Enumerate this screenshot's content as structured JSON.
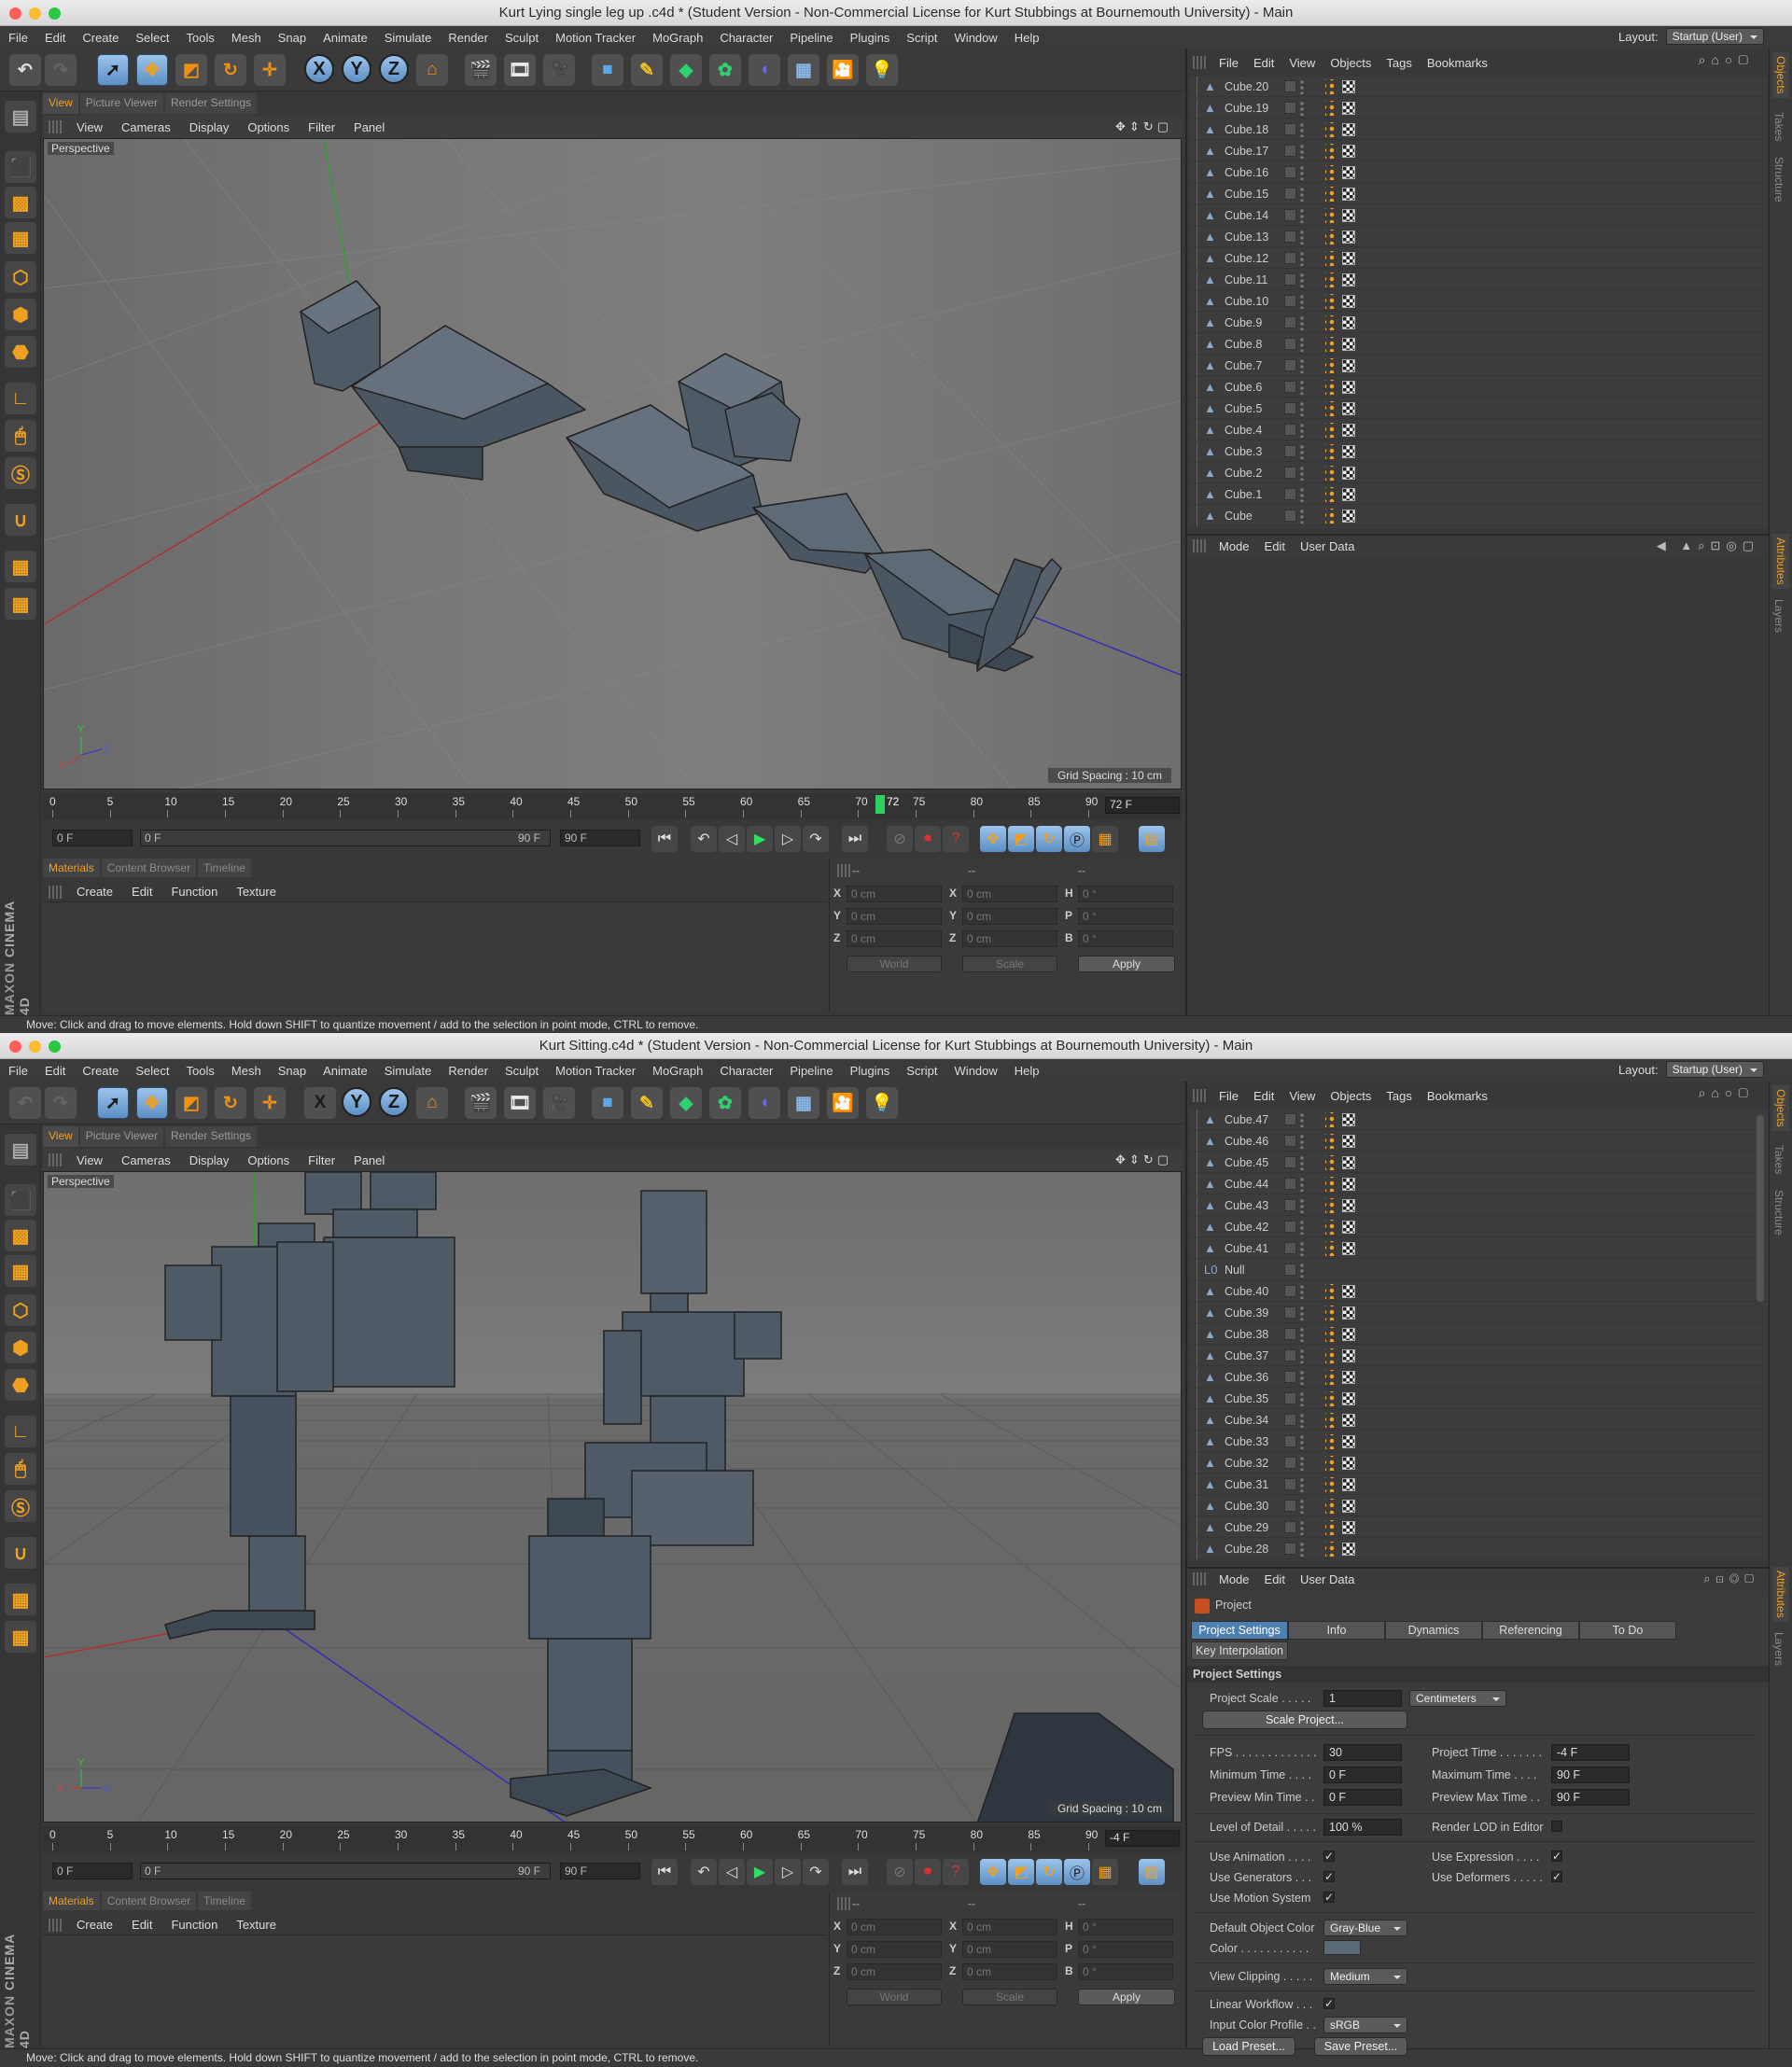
{
  "menus": [
    "File",
    "Edit",
    "Create",
    "Select",
    "Tools",
    "Mesh",
    "Snap",
    "Animate",
    "Simulate",
    "Render",
    "Sculpt",
    "Motion Tracker",
    "MoGraph",
    "Character",
    "Pipeline",
    "Plugins",
    "Script",
    "Window",
    "Help"
  ],
  "layout_label": "Layout:",
  "layout_value": "Startup (User)",
  "viewport_tabs": [
    "View",
    "Picture Viewer",
    "Render Settings"
  ],
  "viewport_menu": [
    "View",
    "Cameras",
    "Display",
    "Options",
    "Filter",
    "Panel"
  ],
  "perspective_label": "Perspective",
  "grid_spacing": "Grid Spacing : 10 cm",
  "timeline_ticks": [
    "0",
    "5",
    "10",
    "15",
    "20",
    "25",
    "30",
    "35",
    "40",
    "45",
    "50",
    "55",
    "60",
    "65",
    "70",
    "75",
    "80",
    "85",
    "90"
  ],
  "frame_start_field": "0 F",
  "range_left": "0 F",
  "range_right": "90 F",
  "frame_end_field": "90 F",
  "lower_tabs": [
    "Materials",
    "Content Browser",
    "Timeline"
  ],
  "material_menu": [
    "Create",
    "Edit",
    "Function",
    "Texture"
  ],
  "coords": {
    "dashes": [
      "--",
      "--",
      "--"
    ],
    "rows": [
      {
        "a": "X",
        "v1": "0 cm",
        "b": "X",
        "v2": "0 cm",
        "c": "H",
        "v3": "0 °"
      },
      {
        "a": "Y",
        "v1": "0 cm",
        "b": "Y",
        "v2": "0 cm",
        "c": "P",
        "v3": "0 °"
      },
      {
        "a": "Z",
        "v1": "0 cm",
        "b": "Z",
        "v2": "0 cm",
        "c": "B",
        "v3": "0 °"
      }
    ],
    "world": "World",
    "scale": "Scale",
    "apply": "Apply"
  },
  "status_text": "Move: Click and drag to move elements. Hold down SHIFT to quantize movement / add to the selection in point mode, CTRL to remove.",
  "object_menu": [
    "File",
    "Edit",
    "View",
    "Objects",
    "Tags",
    "Bookmarks"
  ],
  "attr_menu": [
    "Mode",
    "Edit",
    "User Data"
  ],
  "side_tabs_top": [
    "Objects",
    "Takes",
    "Structure"
  ],
  "side_tabs_bottom": [
    "Attributes",
    "Layers"
  ],
  "brand": {
    "maxon": "MAXON",
    "c4d": "CINEMA 4D"
  },
  "window1": {
    "title": "Kurt Lying single leg up .c4d * (Student Version - Non-Commercial License for Kurt Stubbings at Bournemouth University) - Main",
    "current_frame_marker": "72",
    "frame_field": "72 F",
    "current_frame": 72,
    "objects": [
      "Cube.20",
      "Cube.19",
      "Cube.18",
      "Cube.17",
      "Cube.16",
      "Cube.15",
      "Cube.14",
      "Cube.13",
      "Cube.12",
      "Cube.11",
      "Cube.10",
      "Cube.9",
      "Cube.8",
      "Cube.7",
      "Cube.6",
      "Cube.5",
      "Cube.4",
      "Cube.3",
      "Cube.2",
      "Cube.1",
      "Cube"
    ]
  },
  "window2": {
    "title": "Kurt Sitting.c4d * (Student Version - Non-Commercial License for Kurt Stubbings at Bournemouth University) - Main",
    "frame_field": "-4 F",
    "objects": [
      "Cube.47",
      "Cube.46",
      "Cube.45",
      "Cube.44",
      "Cube.43",
      "Cube.42",
      "Cube.41",
      "Null",
      "Cube.40",
      "Cube.39",
      "Cube.38",
      "Cube.37",
      "Cube.36",
      "Cube.35",
      "Cube.34",
      "Cube.33",
      "Cube.32",
      "Cube.31",
      "Cube.30",
      "Cube.29",
      "Cube.28"
    ],
    "project": {
      "header": "Project",
      "tabs": [
        "Project Settings",
        "Info",
        "Dynamics",
        "Referencing",
        "To Do"
      ],
      "tab2": "Key Interpolation",
      "section": "Project Settings",
      "project_scale_label": "Project Scale . . . . .",
      "project_scale_value": "1",
      "project_scale_unit": "Centimeters",
      "scale_project_button": "Scale Project...",
      "fps_label": "FPS . . . . . . . . . . . . .",
      "fps_value": "30",
      "project_time_label": "Project Time . . . . . . .",
      "project_time_value": "-4 F",
      "min_time_label": "Minimum Time . . . .",
      "min_time_value": "0 F",
      "max_time_label": "Maximum Time . . . .",
      "max_time_value": "90 F",
      "prev_min_label": "Preview Min Time . .",
      "prev_min_value": "0 F",
      "prev_max_label": "Preview Max Time . .",
      "prev_max_value": "90 F",
      "lod_label": "Level of Detail . . . . .",
      "lod_value": "100 %",
      "render_lod_label": "Render LOD in Editor",
      "use_animation_label": "Use Animation . . . .",
      "use_expression_label": "Use Expression . . . .",
      "use_generators_label": "Use Generators . . .",
      "use_deformers_label": "Use Deformers . . . . .",
      "use_motion_label": "Use Motion System",
      "default_color_label": "Default Object Color",
      "default_color_value": "Gray-Blue",
      "color_label": "Color . . . . . . . . . . .",
      "view_clipping_label": "View Clipping . . . . .",
      "view_clipping_value": "Medium",
      "linear_workflow_label": "Linear Workflow . . .",
      "input_color_label": "Input Color Profile . .",
      "input_color_value": "sRGB",
      "load_preset": "Load Preset...",
      "save_preset": "Save Preset..."
    }
  }
}
